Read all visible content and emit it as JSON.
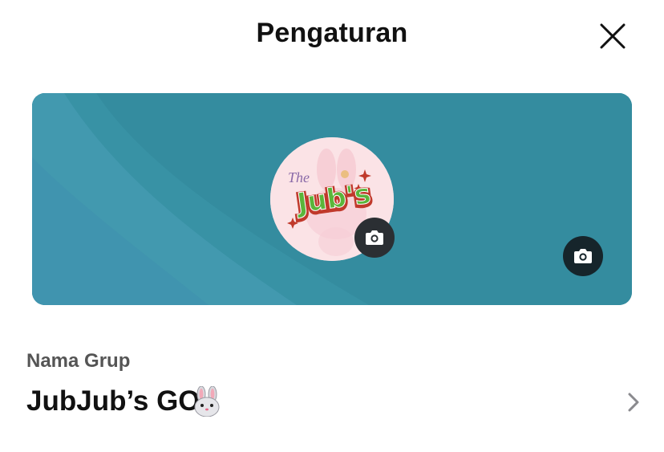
{
  "header": {
    "title": "Pengaturan",
    "close_icon": "close-icon"
  },
  "cover": {
    "background_color": "#348c9f",
    "camera_icon": "camera-icon"
  },
  "avatar": {
    "logo_text_top": "The",
    "logo_text_main": "Jub's",
    "camera_icon": "camera-icon"
  },
  "group_name": {
    "label": "Nama Grup",
    "value": "JubJub’s GO",
    "emoji_icon": "rabbit-face-icon",
    "chevron_icon": "chevron-right-icon"
  }
}
